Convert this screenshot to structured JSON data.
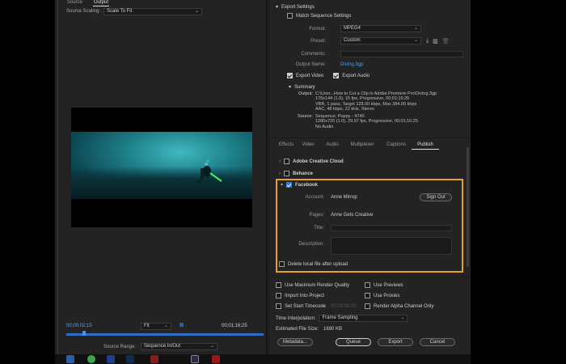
{
  "left": {
    "tabs": [
      "Source",
      "Output"
    ],
    "active_tab": "Output",
    "source_scaling_label": "Source Scaling:",
    "source_scaling_value": "Scale To Fit",
    "timecode_start": "00;00;02;15",
    "fit_value": "Fit",
    "timecode_end": "00;01;16;25",
    "source_range_label": "Source Range:",
    "source_range_value": "Sequence In/Out"
  },
  "export": {
    "section_title": "Export Settings",
    "match_sequence": "Match Sequence Settings",
    "format_label": "Format:",
    "format_value": "MPEG4",
    "preset_label": "Preset:",
    "preset_value": "Custom",
    "comments_label": "Comments:",
    "output_name_label": "Output Name:",
    "output_name_value": "Diving.3gp",
    "export_video": "Export Video",
    "export_audio": "Export Audio",
    "summary_title": "Summary",
    "output_label": "Output:",
    "output_lines": [
      "C:\\User...How to Cut a Clip in Adobe Premiere Pro\\Diving.3gp",
      "176x144 (1.0), 15 fps, Progressive, 00;01;16;25",
      "VBR, 1 pass, Target 128.00 kbps, Max 384.00 kbps",
      "AAC, 48 kbps, 22 kHz, Stereo"
    ],
    "source_label": "Source:",
    "source_lines": [
      "Sequence, Puppy - 4740",
      "1280x720 (1.0), 29.97 fps, Progressive, 00;01;16;25",
      "No Audio"
    ]
  },
  "publish_tabs": [
    "Effects",
    "Video",
    "Audio",
    "Multiplexer",
    "Captions",
    "Publish"
  ],
  "active_publish_tab": "Publish",
  "publish": {
    "adobe_cc": "Adobe Creative Cloud",
    "behance": "Behance",
    "facebook": "Facebook",
    "account_label": "Account:",
    "account_value": "Anne Mirrop",
    "sign_out": "Sign Out",
    "pages_label": "Pages:",
    "pages_value": "Anne Gets Creative",
    "title_label": "Title:",
    "description_label": "Description:",
    "delete_local": "Delete local file after upload"
  },
  "options": {
    "max_render_quality": "Use Maximum Render Quality",
    "use_previews": "Use Previews",
    "import_into_project": "Import Into Project",
    "use_proxies": "Use Proxies",
    "set_start_timecode": "Set Start Timecode",
    "start_timecode_value": "00;00;00;00",
    "render_alpha": "Render Alpha Channel Only",
    "time_interpolation_label": "Time Interpolation:",
    "time_interpolation_value": "Frame Sampling",
    "file_size_label": "Estimated File Size:",
    "file_size_value": "1690 KB"
  },
  "buttons": {
    "metadata": "Metadata...",
    "queue": "Queue",
    "export": "Export",
    "cancel": "Cancel"
  },
  "colors": {
    "accent_blue": "#2d7ae5",
    "highlight_orange": "#e8a020",
    "panel_bg": "#232323"
  }
}
